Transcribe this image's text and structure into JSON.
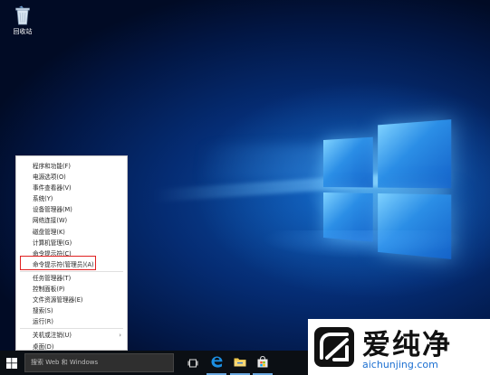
{
  "desktop": {
    "recycle_bin_label": "回收站"
  },
  "context_menu": {
    "items": [
      {
        "label": "程序和功能(F)"
      },
      {
        "label": "电源选项(O)"
      },
      {
        "label": "事件查看器(V)"
      },
      {
        "label": "系统(Y)"
      },
      {
        "label": "设备管理器(M)"
      },
      {
        "label": "网络连接(W)"
      },
      {
        "label": "磁盘管理(K)"
      },
      {
        "label": "计算机管理(G)"
      },
      {
        "label": "命令提示符(C)"
      },
      {
        "label": "命令提示符(管理员)(A)",
        "highlighted": true
      },
      {
        "label": "任务管理器(T)"
      },
      {
        "label": "控制面板(P)"
      },
      {
        "label": "文件资源管理器(E)"
      },
      {
        "label": "搜索(S)"
      },
      {
        "label": "运行(R)"
      },
      {
        "label": "关机或注销(U)",
        "has_submenu": true
      },
      {
        "label": "桌面(D)"
      }
    ],
    "highlight_color": "#e02020"
  },
  "taskbar": {
    "search_placeholder": "搜索 Web 和 Windows",
    "icons": [
      "windows-start-icon",
      "task-view-icon",
      "edge-icon",
      "file-explorer-icon",
      "store-icon"
    ]
  },
  "watermark": {
    "brand": "爱纯净",
    "url": "aichunjing.com"
  },
  "colors": {
    "accent": "#1b6fd1",
    "taskbar": "#0b0f14"
  }
}
